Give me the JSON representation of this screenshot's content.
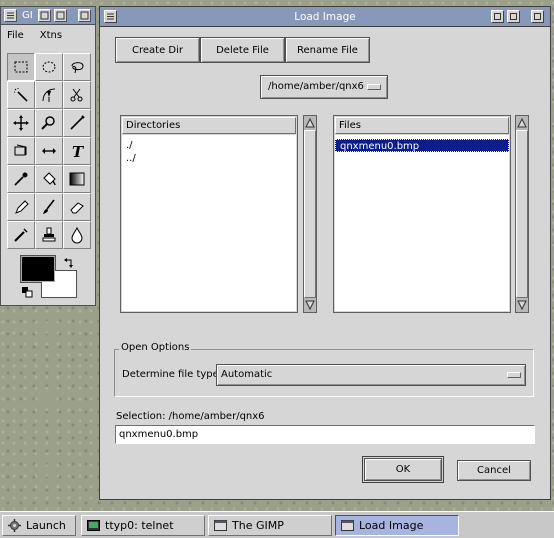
{
  "toolbox": {
    "title": "GIMP",
    "title_shown": "GI",
    "menu": [
      "File",
      "Xtns"
    ],
    "tools": [
      "rect-select-icon",
      "ellipse-select-icon",
      "lasso-icon",
      "magic-wand-icon",
      "bezier-select-icon",
      "intelligent-scissors-icon",
      "move-icon",
      "magnify-icon",
      "crop-icon",
      "transform-icon",
      "flip-icon",
      "text-icon",
      "color-picker-icon",
      "bucket-fill-icon",
      "blend-icon",
      "pencil-icon",
      "paintbrush-icon",
      "eraser-icon",
      "airbrush-icon",
      "clone-icon",
      "convolve-icon"
    ],
    "fg_color": "#000000",
    "bg_color": "#ffffff"
  },
  "dialog": {
    "title": "Load Image",
    "buttons": {
      "create_dir": "Create Dir",
      "delete_file": "Delete File",
      "rename_file": "Rename File"
    },
    "path": "/home/amber/qnx6",
    "directories": {
      "header": "Directories",
      "items": [
        "./",
        "../"
      ]
    },
    "files": {
      "header": "Files",
      "items": [
        "qnxmenu0.bmp"
      ],
      "selected": "qnxmenu0.bmp"
    },
    "open_options": {
      "legend": "Open Options",
      "file_type_label": "Determine file type:",
      "file_type_value": "Automatic"
    },
    "selection_label": "Selection: /home/amber/qnx6",
    "selection_value": "qnxmenu0.bmp",
    "ok": "OK",
    "cancel": "Cancel"
  },
  "taskbar": {
    "items": [
      {
        "label": "Launch",
        "icon": "gear-icon"
      },
      {
        "label": "ttyp0: telnet",
        "icon": "terminal-icon"
      },
      {
        "label": "The GIMP",
        "icon": "gimp-icon"
      },
      {
        "label": "Load Image",
        "icon": "window-icon",
        "active": true
      }
    ]
  },
  "colors": {
    "titlebar": "#8898b8",
    "selection": "#0c1c8c",
    "window": "#d6d6d6"
  }
}
